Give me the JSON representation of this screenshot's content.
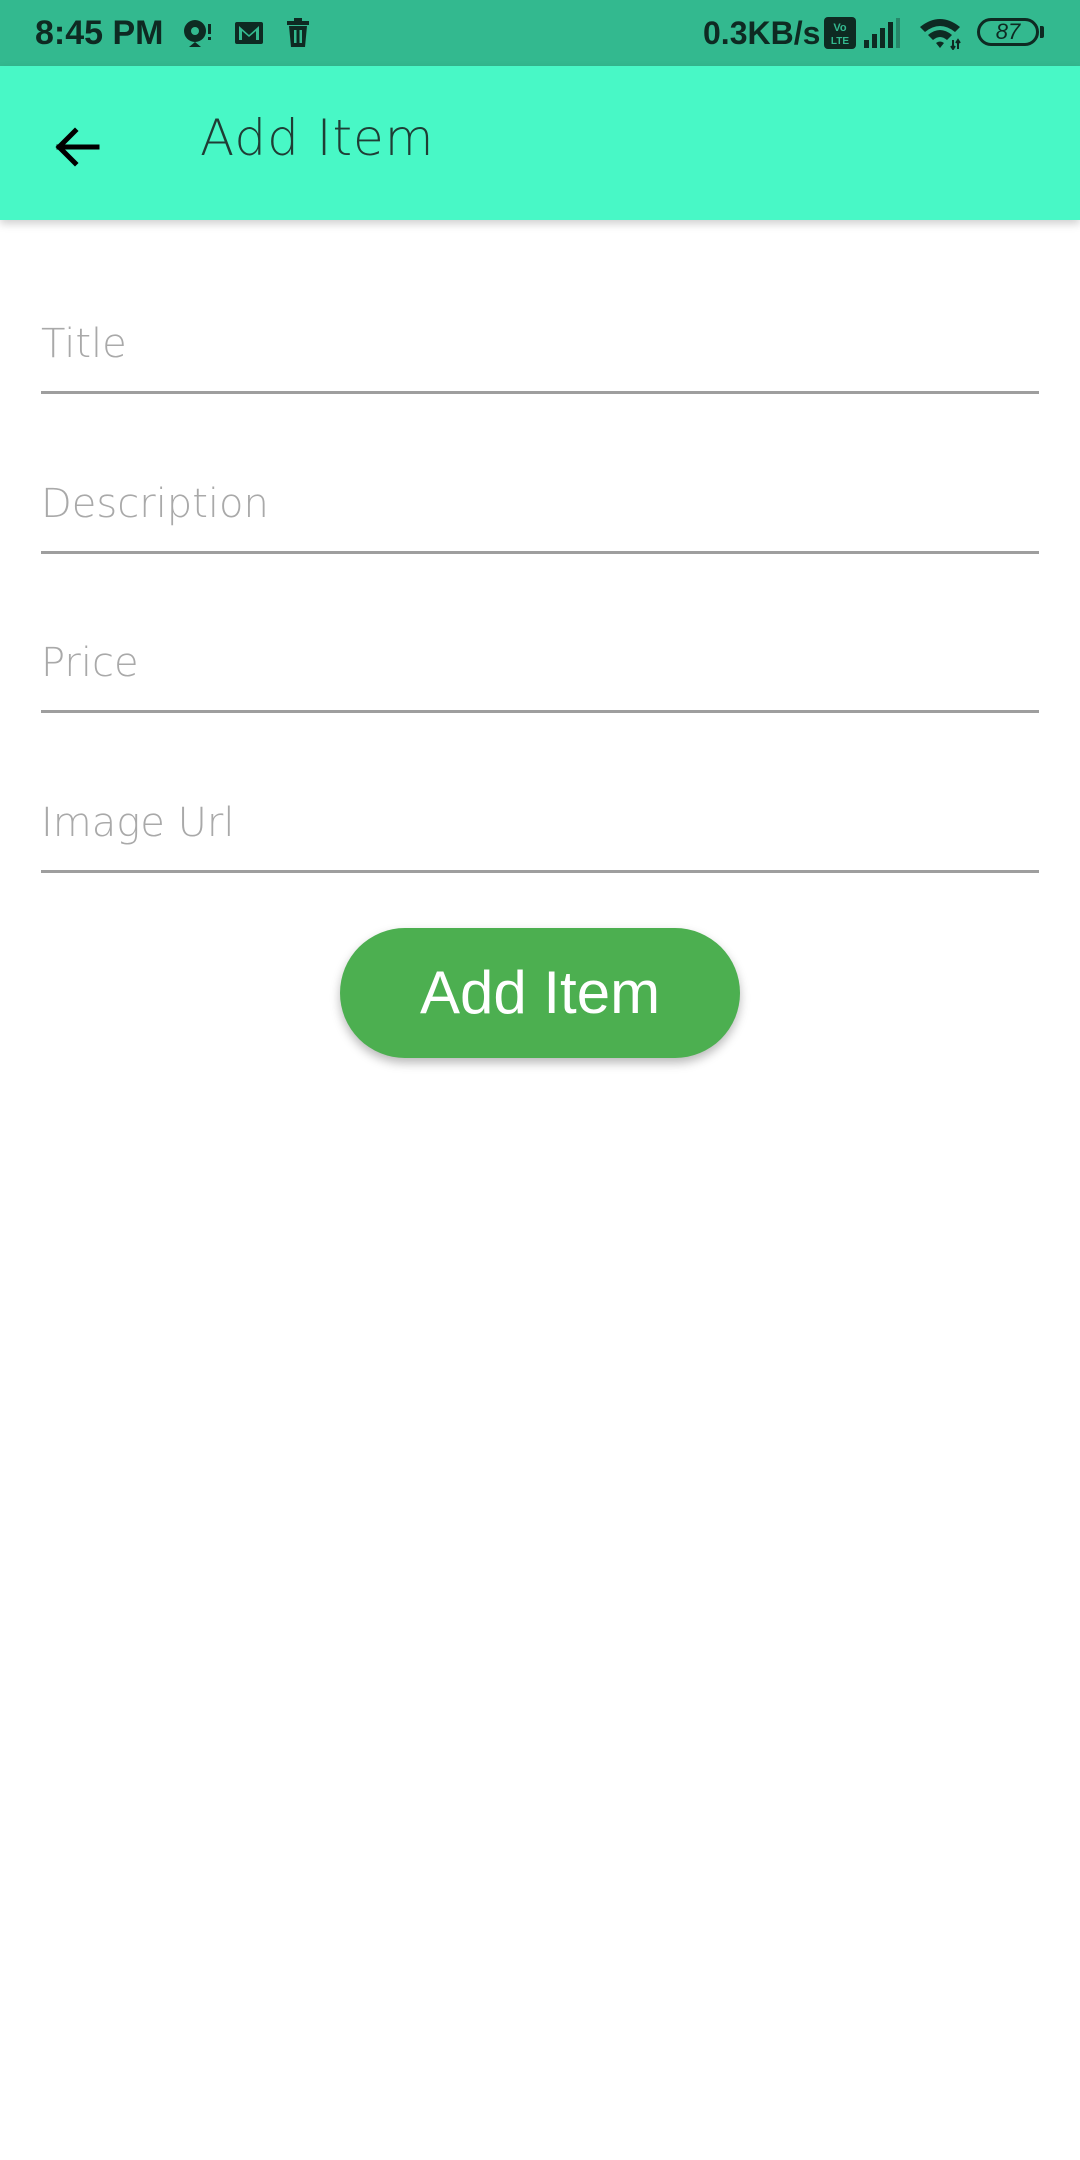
{
  "status_bar": {
    "time": "8:45 PM",
    "network_speed": "0.3KB/s",
    "battery_level": "87",
    "volte_label": "Vo LTE",
    "icons": [
      "location-icon",
      "gmail-icon",
      "trash-icon",
      "volte-icon",
      "signal-icon",
      "wifi-icon",
      "battery-icon"
    ],
    "bg_color": "#33b98f"
  },
  "app_bar": {
    "title": "Add Item",
    "back_icon": "arrow-left-icon",
    "bg_color": "#48f8c6"
  },
  "form": {
    "title_placeholder": "Title",
    "description_placeholder": "Description",
    "price_placeholder": "Price",
    "image_url_placeholder": "Image Url"
  },
  "submit": {
    "label": "Add Item",
    "color": "#4caf50"
  }
}
